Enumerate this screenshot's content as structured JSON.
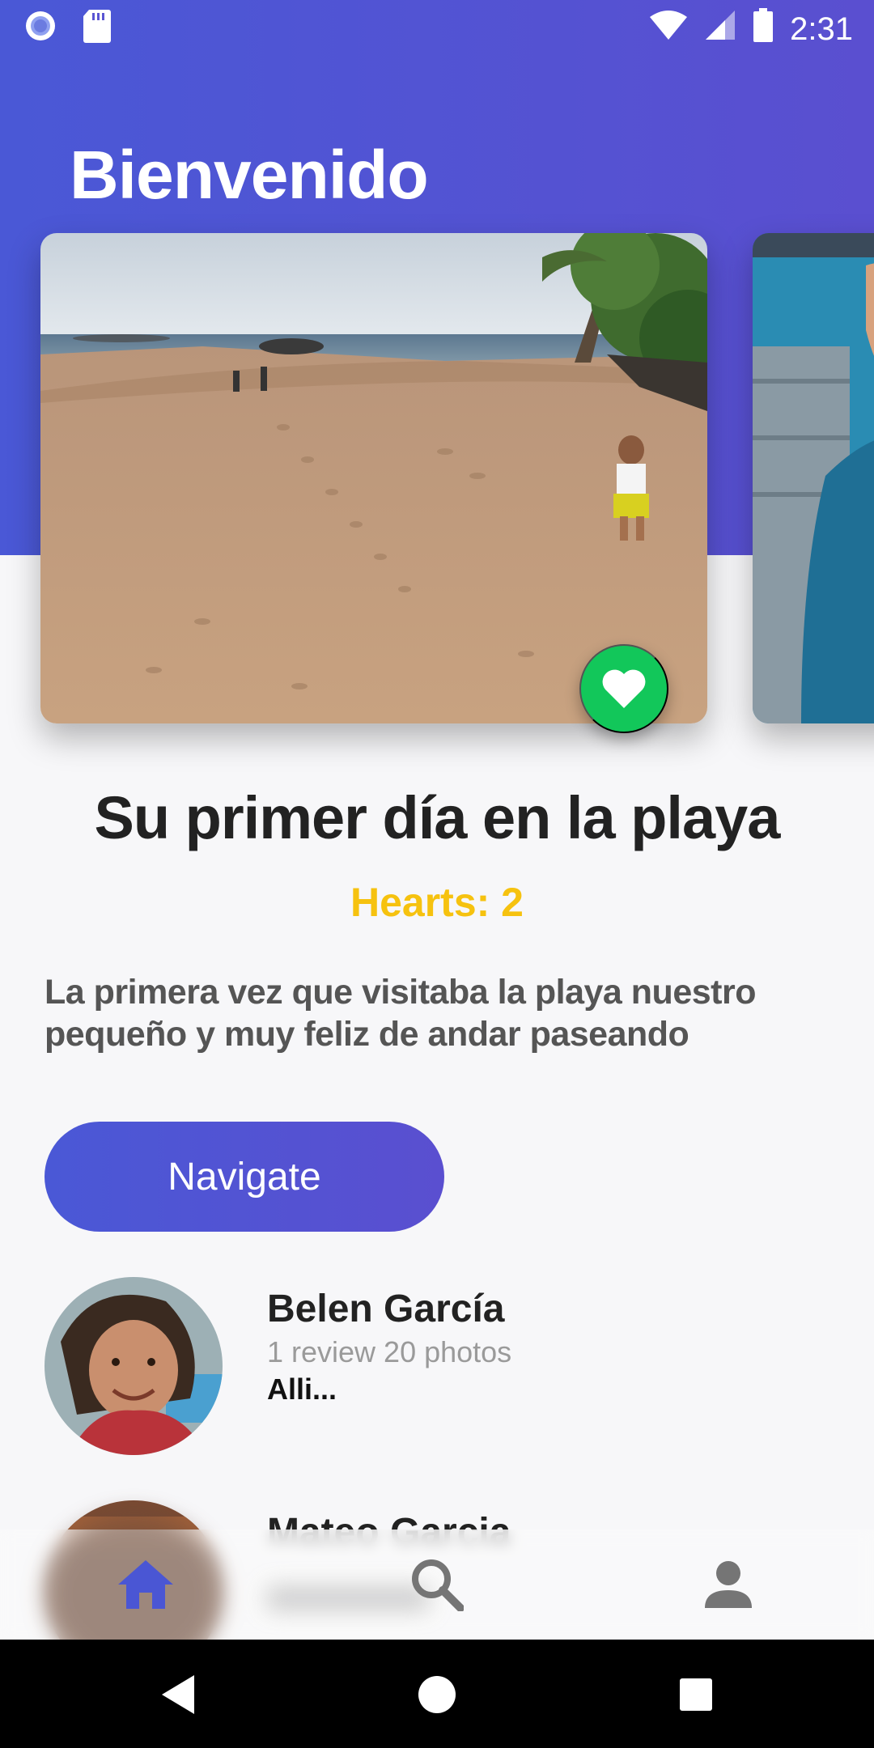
{
  "status_bar": {
    "time": "2:31",
    "icons": [
      "notification-dot-icon",
      "sd-card-icon",
      "wifi-icon",
      "signal-icon",
      "battery-icon"
    ]
  },
  "header": {
    "title": "Bienvenido"
  },
  "post": {
    "title": "Su primer día en la playa",
    "hearts_label": "Hearts: 2",
    "description": "La primera vez que visitaba la playa nuestro pequeño y muy feliz de andar paseando",
    "navigate_label": "Navigate",
    "hearts_count": 2
  },
  "reviews": [
    {
      "name": "Belen García",
      "meta": "1 review 20 photos",
      "snippet": "Alli..."
    },
    {
      "name": "Mateo Garcia",
      "meta": "",
      "snippet": ""
    }
  ],
  "bottom_nav": {
    "items": [
      {
        "icon": "home-icon",
        "active": true
      },
      {
        "icon": "search-icon",
        "active": false
      },
      {
        "icon": "profile-icon",
        "active": false
      }
    ],
    "active_color": "#4a56d4",
    "inactive_color": "#757575"
  },
  "colors": {
    "accent_gradient_start": "#4a58d6",
    "accent_gradient_end": "#5a4fd0",
    "heart_button": "#12c75a",
    "hearts_text": "#f6c20f"
  }
}
